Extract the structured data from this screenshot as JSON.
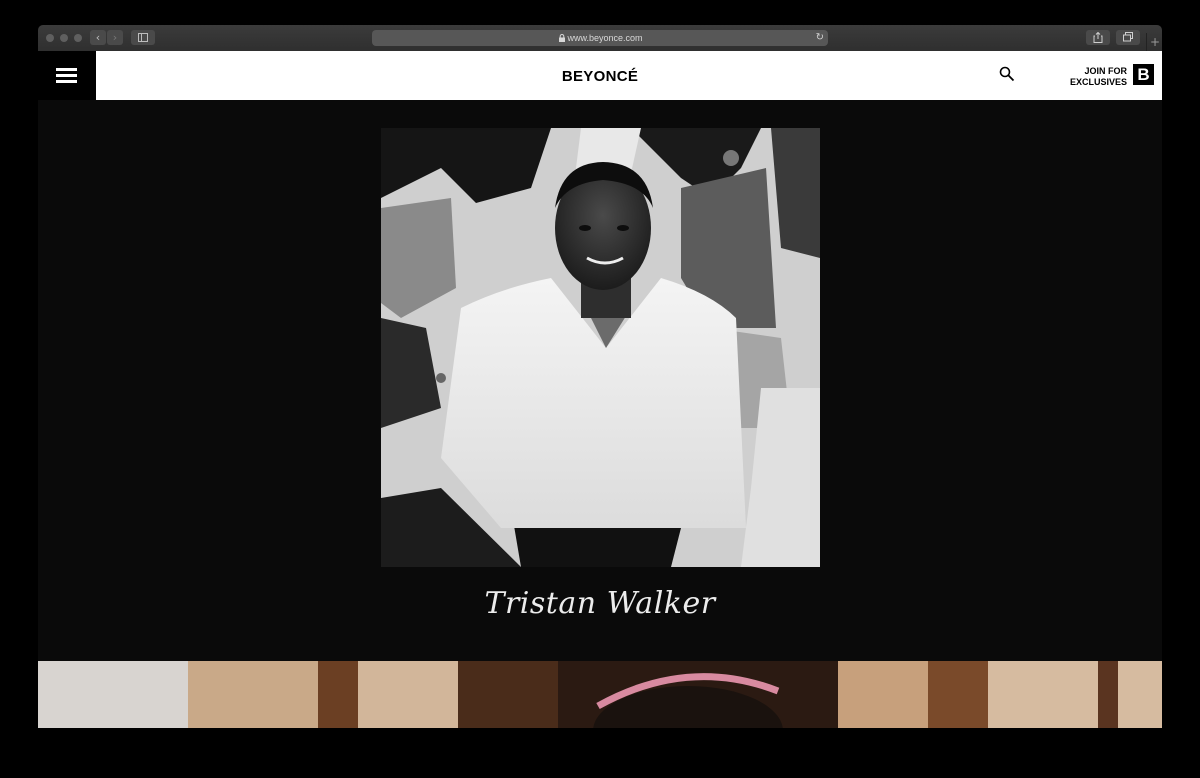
{
  "browser": {
    "url": "www.beyonce.com",
    "back_glyph": "‹",
    "forward_glyph": "›",
    "reload_glyph": "↻",
    "newtab_glyph": "+"
  },
  "site": {
    "logo": "BEYONCÉ",
    "join_line1": "JOIN FOR",
    "join_line2": "EXCLUSIVES",
    "badge_letter": "B"
  },
  "feature": {
    "caption": "Tristan Walker"
  },
  "icons": [
    "menu-icon",
    "search-icon",
    "lock-icon",
    "share-icon",
    "tabs-icon",
    "sidebar-icon"
  ]
}
